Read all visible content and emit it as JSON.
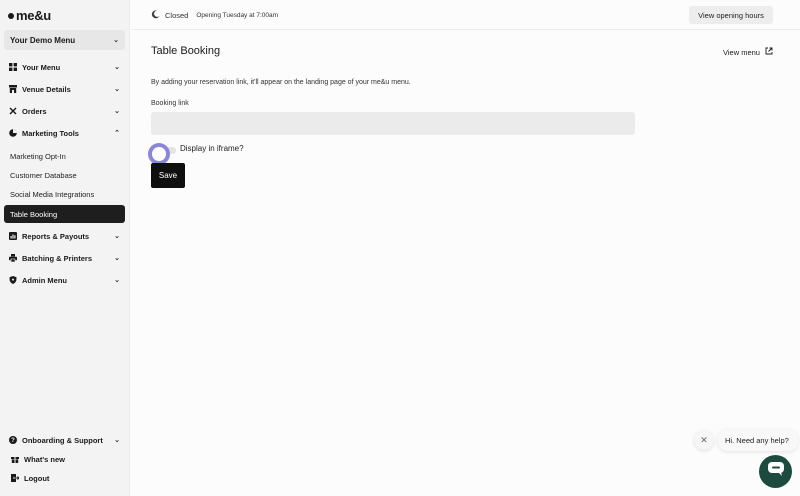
{
  "app": {
    "logo_text": "me&u"
  },
  "sidebar": {
    "menu_select": "Your Demo Menu",
    "items": [
      {
        "label": "Your Menu",
        "icon": "grid-icon"
      },
      {
        "label": "Venue Details",
        "icon": "store-icon"
      },
      {
        "label": "Orders",
        "icon": "utensils-icon"
      },
      {
        "label": "Marketing Tools",
        "icon": "pie-chart-icon"
      }
    ],
    "marketing_sub": [
      {
        "label": "Marketing Opt-In"
      },
      {
        "label": "Customer Database"
      },
      {
        "label": "Social Media Integrations"
      },
      {
        "label": "Table Booking"
      }
    ],
    "items2": [
      {
        "label": "Reports & Payouts",
        "icon": "reports-icon"
      },
      {
        "label": "Batching & Printers",
        "icon": "printer-icon"
      },
      {
        "label": "Admin Menu",
        "icon": "shield-icon"
      }
    ],
    "bottom": [
      {
        "label": "Onboarding & Support",
        "icon": "help-icon"
      },
      {
        "label": "What's new",
        "icon": "gift-icon"
      },
      {
        "label": "Logout",
        "icon": "logout-icon"
      }
    ]
  },
  "topbar": {
    "status": "Closed",
    "next_open": "Opening Tuesday at 7:00am",
    "hours_button": "View opening hours"
  },
  "main": {
    "title": "Table Booking",
    "view_menu": "View menu",
    "description": "By adding your reservation link, it'll appear on the landing page of your me&u menu.",
    "booking_label": "Booking link",
    "booking_value": "",
    "iframe_label": "Display in iframe?",
    "save_label": "Save"
  },
  "help": {
    "bubble": "Hi. Need any help?"
  },
  "colors": {
    "accent": "#8b86d8",
    "chat": "#1d4a3e",
    "active_nav": "#1e1e1e"
  }
}
